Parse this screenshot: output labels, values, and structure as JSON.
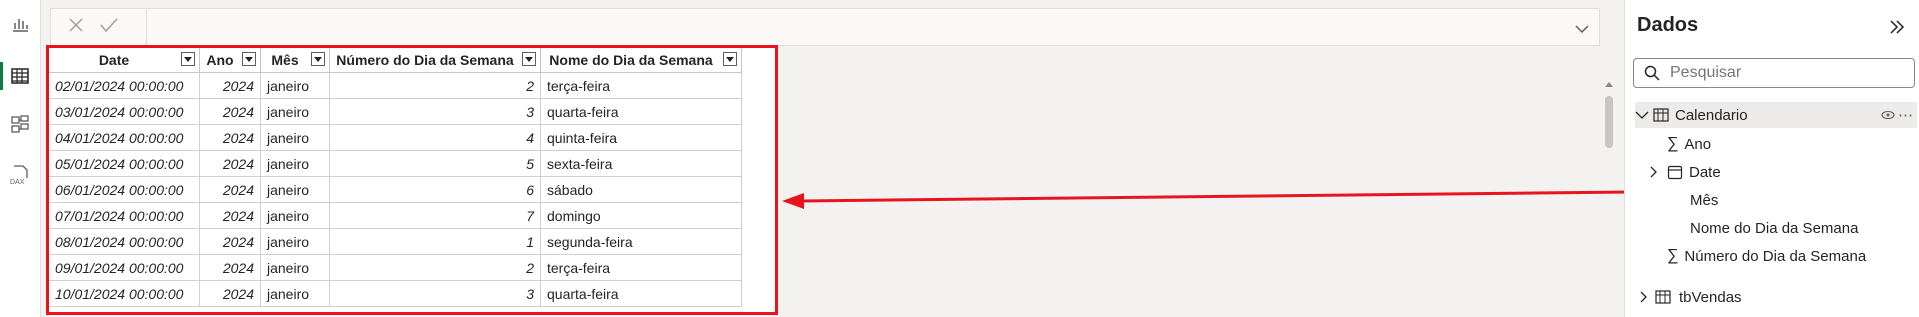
{
  "table": {
    "columns": [
      "Date",
      "Ano",
      "Mês",
      "Número do Dia da Semana",
      "Nome do Dia da Semana"
    ],
    "rows": [
      [
        "02/01/2024 00:00:00",
        "2024",
        "janeiro",
        "2",
        "terça-feira"
      ],
      [
        "03/01/2024 00:00:00",
        "2024",
        "janeiro",
        "3",
        "quarta-feira"
      ],
      [
        "04/01/2024 00:00:00",
        "2024",
        "janeiro",
        "4",
        "quinta-feira"
      ],
      [
        "05/01/2024 00:00:00",
        "2024",
        "janeiro",
        "5",
        "sexta-feira"
      ],
      [
        "06/01/2024 00:00:00",
        "2024",
        "janeiro",
        "6",
        "sábado"
      ],
      [
        "07/01/2024 00:00:00",
        "2024",
        "janeiro",
        "7",
        "domingo"
      ],
      [
        "08/01/2024 00:00:00",
        "2024",
        "janeiro",
        "1",
        "segunda-feira"
      ],
      [
        "09/01/2024 00:00:00",
        "2024",
        "janeiro",
        "2",
        "terça-feira"
      ],
      [
        "10/01/2024 00:00:00",
        "2024",
        "janeiro",
        "3",
        "quarta-feira"
      ]
    ]
  },
  "data_pane": {
    "title": "Dados",
    "search_placeholder": "Pesquisar",
    "calendar_table": "Calendario",
    "fields": {
      "ano": "Ano",
      "date": "Date",
      "mes": "Mês",
      "nome_dia": "Nome do Dia da Semana",
      "numero_dia": "Número do Dia da Semana"
    },
    "other_table": "tbVendas"
  },
  "colors": {
    "highlight": "#e6151d",
    "accent": "#107c41"
  }
}
